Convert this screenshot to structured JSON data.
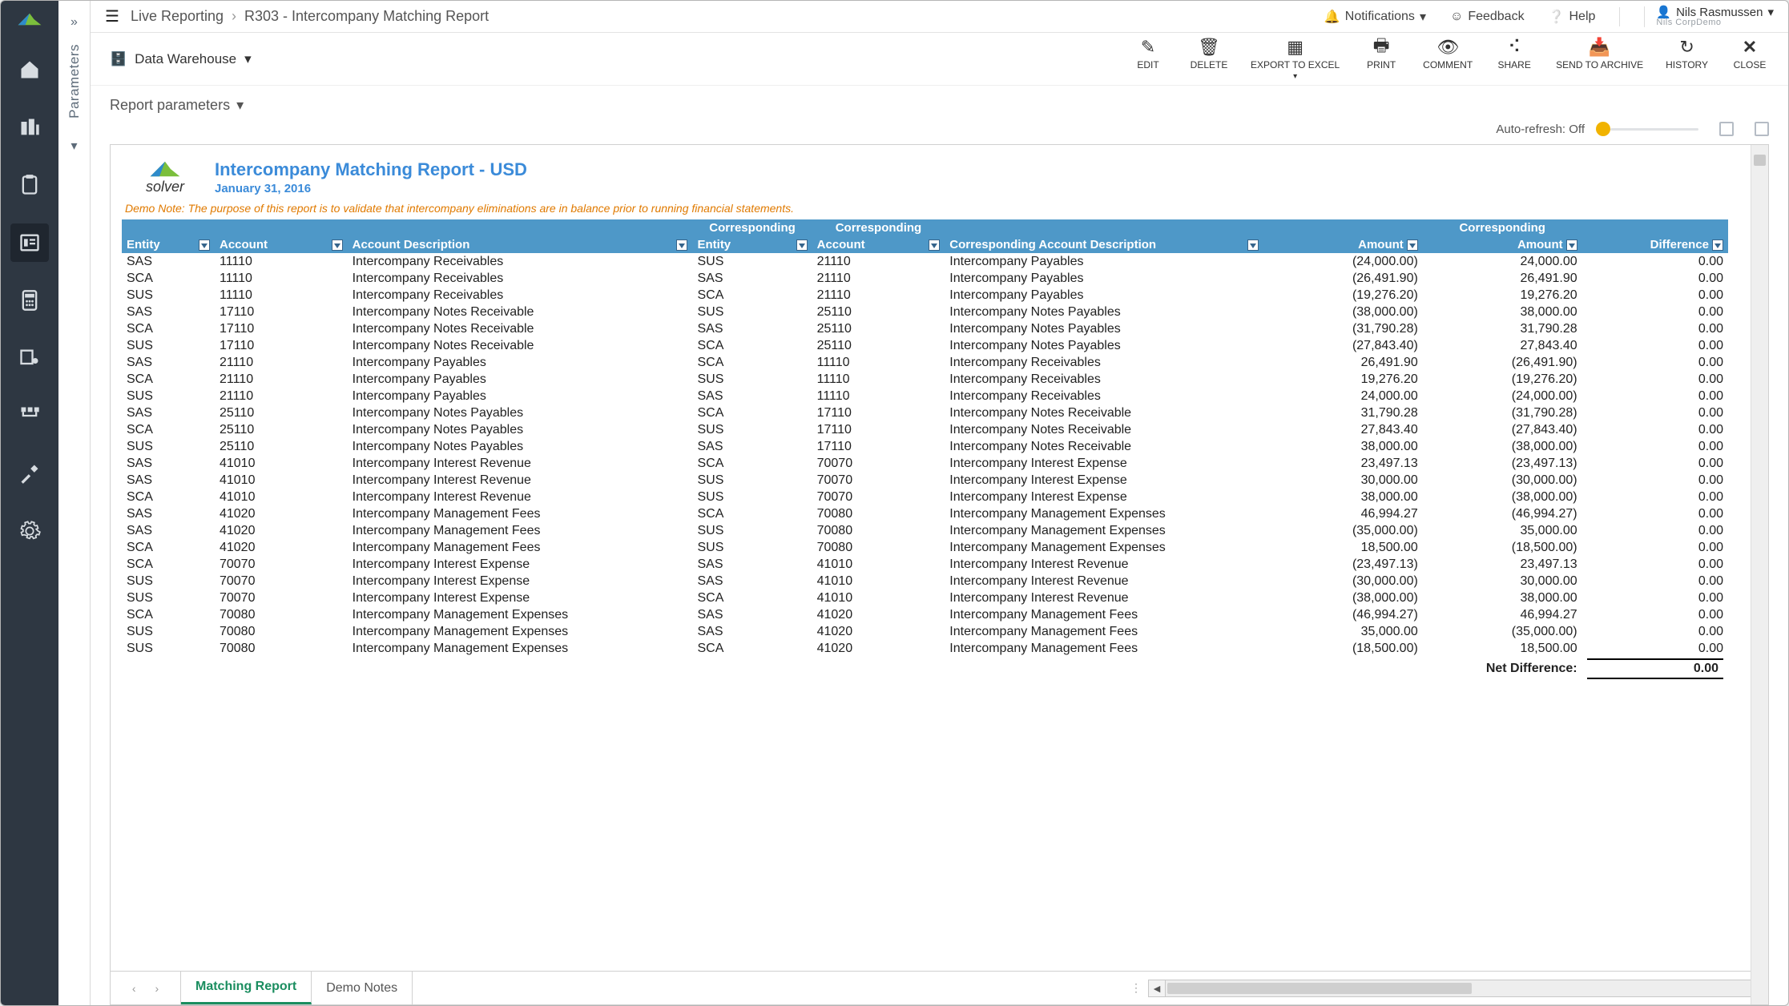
{
  "breadcrumb": {
    "root": "Live Reporting",
    "page": "R303 - Intercompany Matching Report"
  },
  "topbar": {
    "notifications": "Notifications",
    "feedback": "Feedback",
    "help": "Help",
    "user_name": "Nils Rasmussen",
    "user_org": "Nils CorpDemo"
  },
  "source": {
    "label": "Data Warehouse"
  },
  "actions": {
    "edit": "EDIT",
    "delete": "DELETE",
    "export": "EXPORT TO EXCEL",
    "print": "PRINT",
    "comment": "COMMENT",
    "share": "SHARE",
    "archive": "SEND TO ARCHIVE",
    "history": "HISTORY",
    "close": "CLOSE"
  },
  "params_label": "Report parameters",
  "autorefresh": {
    "label": "Auto-refresh:",
    "value": "Off"
  },
  "report": {
    "brand": "solver",
    "title": "Intercompany Matching Report - USD",
    "date": "January 31, 2016",
    "note": "Demo Note: The purpose of this report is to validate that intercompany eliminations are in balance prior to running financial statements.",
    "headers": {
      "entity": "Entity",
      "account": "Account",
      "account_desc": "Account Description",
      "corr_top": "Corresponding",
      "corr_entity": "Entity",
      "corr_account": "Account",
      "corr_account_desc": "Corresponding Account Description",
      "amount": "Amount",
      "corr_amount_top": "Corresponding",
      "corr_amount": "Amount",
      "difference": "Difference"
    },
    "net_label": "Net Difference:",
    "net_value": "0.00"
  },
  "tabs": {
    "active": "Matching Report",
    "other": "Demo Notes"
  },
  "parameters_rail": "Parameters",
  "rows": [
    {
      "e": "SAS",
      "a": "11110",
      "ad": "Intercompany Receivables",
      "ce": "SUS",
      "ca": "21110",
      "cad": "Intercompany Payables",
      "amt": "(24,000.00)",
      "camt": "24,000.00",
      "d": "0.00"
    },
    {
      "e": "SCA",
      "a": "11110",
      "ad": "Intercompany Receivables",
      "ce": "SAS",
      "ca": "21110",
      "cad": "Intercompany Payables",
      "amt": "(26,491.90)",
      "camt": "26,491.90",
      "d": "0.00"
    },
    {
      "e": "SUS",
      "a": "11110",
      "ad": "Intercompany Receivables",
      "ce": "SCA",
      "ca": "21110",
      "cad": "Intercompany Payables",
      "amt": "(19,276.20)",
      "camt": "19,276.20",
      "d": "0.00"
    },
    {
      "e": "SAS",
      "a": "17110",
      "ad": "Intercompany Notes Receivable",
      "ce": "SUS",
      "ca": "25110",
      "cad": "Intercompany Notes Payables",
      "amt": "(38,000.00)",
      "camt": "38,000.00",
      "d": "0.00"
    },
    {
      "e": "SCA",
      "a": "17110",
      "ad": "Intercompany Notes Receivable",
      "ce": "SAS",
      "ca": "25110",
      "cad": "Intercompany Notes Payables",
      "amt": "(31,790.28)",
      "camt": "31,790.28",
      "d": "0.00"
    },
    {
      "e": "SUS",
      "a": "17110",
      "ad": "Intercompany Notes Receivable",
      "ce": "SCA",
      "ca": "25110",
      "cad": "Intercompany Notes Payables",
      "amt": "(27,843.40)",
      "camt": "27,843.40",
      "d": "0.00"
    },
    {
      "e": "SAS",
      "a": "21110",
      "ad": "Intercompany Payables",
      "ce": "SCA",
      "ca": "11110",
      "cad": "Intercompany Receivables",
      "amt": "26,491.90",
      "camt": "(26,491.90)",
      "d": "0.00"
    },
    {
      "e": "SCA",
      "a": "21110",
      "ad": "Intercompany Payables",
      "ce": "SUS",
      "ca": "11110",
      "cad": "Intercompany Receivables",
      "amt": "19,276.20",
      "camt": "(19,276.20)",
      "d": "0.00"
    },
    {
      "e": "SUS",
      "a": "21110",
      "ad": "Intercompany Payables",
      "ce": "SAS",
      "ca": "11110",
      "cad": "Intercompany Receivables",
      "amt": "24,000.00",
      "camt": "(24,000.00)",
      "d": "0.00"
    },
    {
      "e": "SAS",
      "a": "25110",
      "ad": "Intercompany Notes Payables",
      "ce": "SCA",
      "ca": "17110",
      "cad": "Intercompany Notes Receivable",
      "amt": "31,790.28",
      "camt": "(31,790.28)",
      "d": "0.00"
    },
    {
      "e": "SCA",
      "a": "25110",
      "ad": "Intercompany Notes Payables",
      "ce": "SUS",
      "ca": "17110",
      "cad": "Intercompany Notes Receivable",
      "amt": "27,843.40",
      "camt": "(27,843.40)",
      "d": "0.00"
    },
    {
      "e": "SUS",
      "a": "25110",
      "ad": "Intercompany Notes Payables",
      "ce": "SAS",
      "ca": "17110",
      "cad": "Intercompany Notes Receivable",
      "amt": "38,000.00",
      "camt": "(38,000.00)",
      "d": "0.00"
    },
    {
      "e": "SAS",
      "a": "41010",
      "ad": "Intercompany Interest Revenue",
      "ce": "SCA",
      "ca": "70070",
      "cad": "Intercompany Interest Expense",
      "amt": "23,497.13",
      "camt": "(23,497.13)",
      "d": "0.00"
    },
    {
      "e": "SAS",
      "a": "41010",
      "ad": "Intercompany Interest Revenue",
      "ce": "SUS",
      "ca": "70070",
      "cad": "Intercompany Interest Expense",
      "amt": "30,000.00",
      "camt": "(30,000.00)",
      "d": "0.00"
    },
    {
      "e": "SCA",
      "a": "41010",
      "ad": "Intercompany Interest Revenue",
      "ce": "SUS",
      "ca": "70070",
      "cad": "Intercompany Interest Expense",
      "amt": "38,000.00",
      "camt": "(38,000.00)",
      "d": "0.00"
    },
    {
      "e": "SAS",
      "a": "41020",
      "ad": "Intercompany Management Fees",
      "ce": "SCA",
      "ca": "70080",
      "cad": "Intercompany Management Expenses",
      "amt": "46,994.27",
      "camt": "(46,994.27)",
      "d": "0.00"
    },
    {
      "e": "SAS",
      "a": "41020",
      "ad": "Intercompany Management Fees",
      "ce": "SUS",
      "ca": "70080",
      "cad": "Intercompany Management Expenses",
      "amt": "(35,000.00)",
      "camt": "35,000.00",
      "d": "0.00"
    },
    {
      "e": "SCA",
      "a": "41020",
      "ad": "Intercompany Management Fees",
      "ce": "SUS",
      "ca": "70080",
      "cad": "Intercompany Management Expenses",
      "amt": "18,500.00",
      "camt": "(18,500.00)",
      "d": "0.00"
    },
    {
      "e": "SCA",
      "a": "70070",
      "ad": "Intercompany Interest Expense",
      "ce": "SAS",
      "ca": "41010",
      "cad": "Intercompany Interest Revenue",
      "amt": "(23,497.13)",
      "camt": "23,497.13",
      "d": "0.00"
    },
    {
      "e": "SUS",
      "a": "70070",
      "ad": "Intercompany Interest Expense",
      "ce": "SAS",
      "ca": "41010",
      "cad": "Intercompany Interest Revenue",
      "amt": "(30,000.00)",
      "camt": "30,000.00",
      "d": "0.00"
    },
    {
      "e": "SUS",
      "a": "70070",
      "ad": "Intercompany Interest Expense",
      "ce": "SCA",
      "ca": "41010",
      "cad": "Intercompany Interest Revenue",
      "amt": "(38,000.00)",
      "camt": "38,000.00",
      "d": "0.00"
    },
    {
      "e": "SCA",
      "a": "70080",
      "ad": "Intercompany Management Expenses",
      "ce": "SAS",
      "ca": "41020",
      "cad": "Intercompany Management Fees",
      "amt": "(46,994.27)",
      "camt": "46,994.27",
      "d": "0.00"
    },
    {
      "e": "SUS",
      "a": "70080",
      "ad": "Intercompany Management Expenses",
      "ce": "SAS",
      "ca": "41020",
      "cad": "Intercompany Management Fees",
      "amt": "35,000.00",
      "camt": "(35,000.00)",
      "d": "0.00"
    },
    {
      "e": "SUS",
      "a": "70080",
      "ad": "Intercompany Management Expenses",
      "ce": "SCA",
      "ca": "41020",
      "cad": "Intercompany Management Fees",
      "amt": "(18,500.00)",
      "camt": "18,500.00",
      "d": "0.00"
    }
  ]
}
